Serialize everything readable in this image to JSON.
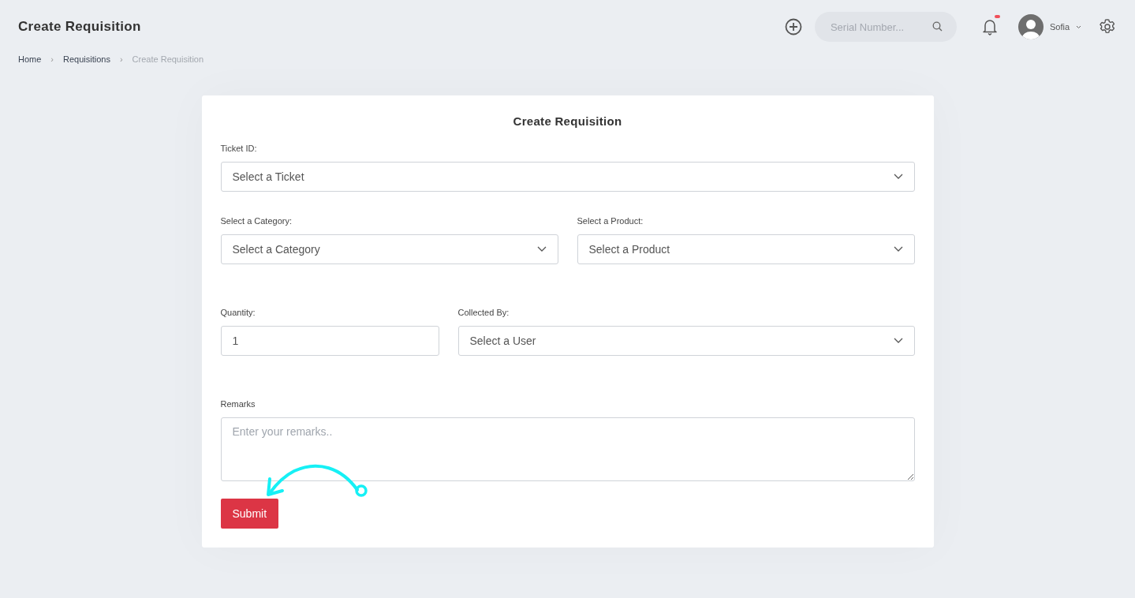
{
  "header": {
    "title": "Create Requisition",
    "search": {
      "placeholder": "Serial Number..."
    },
    "notifications": {
      "unread": true
    },
    "user": {
      "name": "Sofia"
    }
  },
  "breadcrumb": [
    {
      "label": "Home",
      "current": false
    },
    {
      "separator": "›",
      "label": "Requisitions",
      "current": false
    },
    {
      "separator": "›",
      "label": "Create Requisition",
      "current": true
    }
  ],
  "form": {
    "title": "Create Requisition",
    "rows": [
      {
        "fields": [
          {
            "kind": "select",
            "label": "Ticket ID:",
            "placeholder": "Select a Ticket"
          }
        ]
      },
      {
        "fields": [
          {
            "kind": "select",
            "label": "Select a Category:",
            "placeholder": "Select a Category"
          },
          {
            "kind": "select",
            "label": "Select a Product:",
            "placeholder": "Select a Product"
          }
        ]
      },
      {
        "fields": [
          {
            "kind": "input",
            "label": "Quantity:",
            "value": "1"
          },
          {
            "kind": "select",
            "label": "Collected By:",
            "placeholder": "Select a User"
          }
        ]
      },
      {
        "fields": [
          {
            "kind": "textarea",
            "label": "Remarks",
            "placeholder": "Enter your remarks.."
          }
        ]
      }
    ],
    "submit": "Submit"
  }
}
